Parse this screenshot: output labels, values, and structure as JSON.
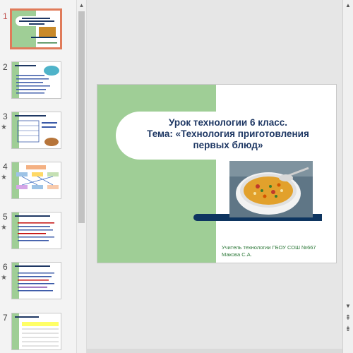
{
  "thumbnails": [
    {
      "number": "1",
      "has_animation": false
    },
    {
      "number": "2",
      "has_animation": false
    },
    {
      "number": "3",
      "has_animation": true
    },
    {
      "number": "4",
      "has_animation": true
    },
    {
      "number": "5",
      "has_animation": true
    },
    {
      "number": "6",
      "has_animation": true
    },
    {
      "number": "7",
      "has_animation": false
    }
  ],
  "slide": {
    "title": "Урок технологии 6 класс. Тема: «Технология приготовления первых блюд»",
    "title_lines": [
      "Урок технологии 6 класс.",
      "Тема: «Технология приготовления",
      "первых блюд»"
    ],
    "author_line1": "Учитель технологии ГБОУ СОШ №667",
    "author_line2": "Макова С.А."
  },
  "colors": {
    "accent_active": "#e07b5a",
    "slide_green": "#9fce96",
    "title_text": "#1f3864",
    "dark_bar": "#0e3560",
    "author_text": "#2f7a3b"
  },
  "icons": {
    "animation_marker": "star-icon",
    "scroll_up": "arrow-up-icon",
    "scroll_down": "arrow-down-icon",
    "prev_slide": "double-arrow-up-icon",
    "next_slide": "double-arrow-down-icon"
  }
}
